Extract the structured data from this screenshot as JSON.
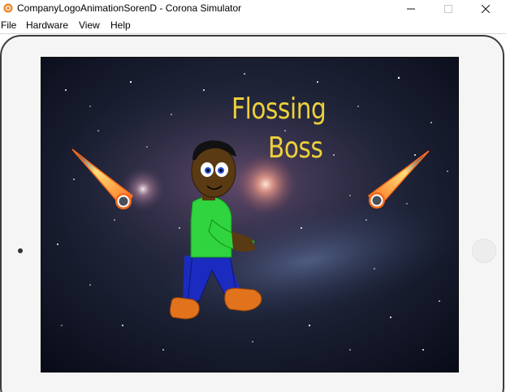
{
  "window": {
    "title": "CompanyLogoAnimationSorenD - Corona Simulator",
    "app_icon": "corona-logo-icon",
    "controls": {
      "minimize_icon": "minimize-icon",
      "maximize_icon": "maximize-icon",
      "close_icon": "close-icon"
    }
  },
  "menubar": {
    "items": [
      {
        "label": "File"
      },
      {
        "label": "Hardware"
      },
      {
        "label": "View"
      },
      {
        "label": "Help"
      }
    ]
  },
  "device": {
    "type": "tablet-frame",
    "home_button_icon": "home-button-icon"
  },
  "game": {
    "title_line1": "Flossing",
    "title_line2": "Boss",
    "background": "galaxy-starfield",
    "characters": [
      "dancing-boy"
    ],
    "projectiles": [
      "fireball-left",
      "fireball-right"
    ]
  },
  "colors": {
    "title_text": "#ecd03a",
    "fireball_outer": "#f26a1b",
    "fireball_inner": "#ffffff",
    "shirt": "#2fd43e",
    "pants": "#1b2bbf",
    "shoes": "#e0731c",
    "skin": "#5a3a12"
  }
}
